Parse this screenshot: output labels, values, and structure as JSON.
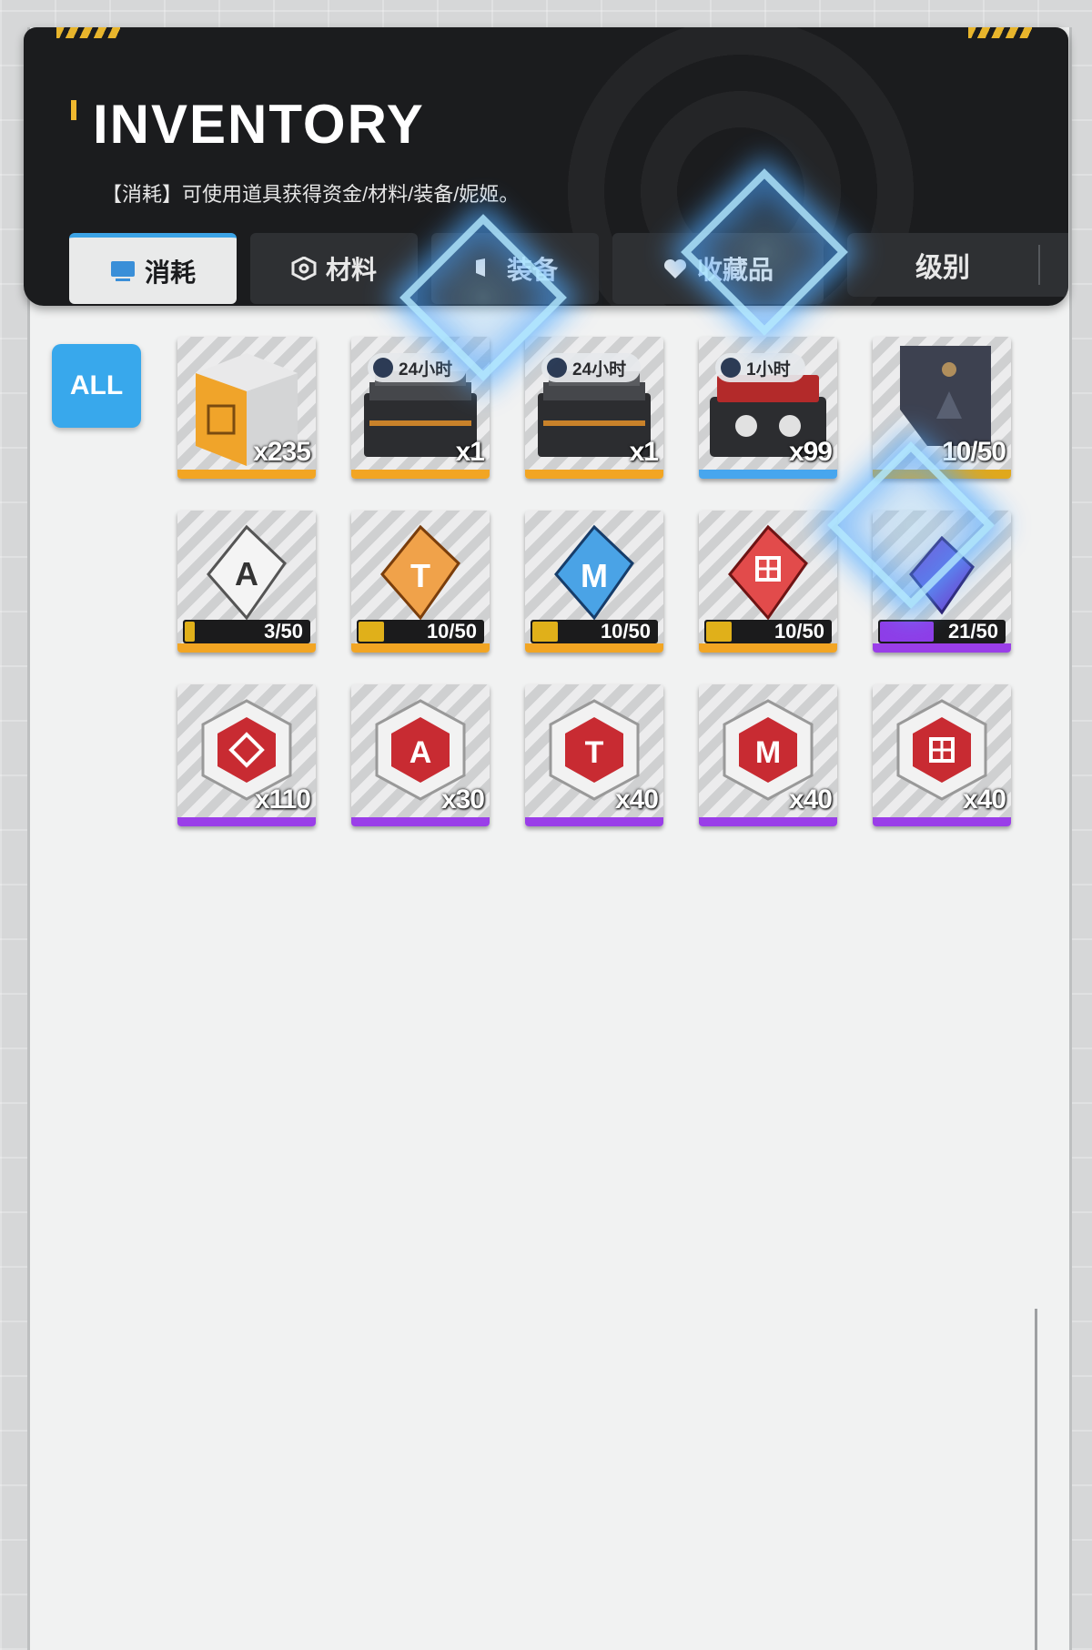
{
  "header": {
    "title": "INVENTORY",
    "subtitle": "【消耗】可使用道具获得资金/材料/装备/妮姬。"
  },
  "tabs": [
    {
      "label": "消耗",
      "icon": "monitor-icon",
      "active": true
    },
    {
      "label": "材料",
      "icon": "hexagon-icon",
      "active": false
    },
    {
      "label": "装备",
      "icon": "equipment-icon",
      "active": false
    },
    {
      "label": "收藏品",
      "icon": "heart-icon",
      "active": false
    }
  ],
  "sort": {
    "label": "级别",
    "arrow": "▼"
  },
  "filter": {
    "all_label": "ALL"
  },
  "colors": {
    "accent": "#38a8ec",
    "rarity_orange": "#f2a523",
    "rarity_blue": "#47a6ee",
    "rarity_purple": "#9a3ee8",
    "header_bg": "#1b1c1e"
  },
  "items": [
    {
      "name": "supply-crate",
      "count": "x235",
      "rarity": "orange"
    },
    {
      "name": "equipment-case",
      "count": "x1",
      "rarity": "orange",
      "timer": "24小时"
    },
    {
      "name": "equipment-case",
      "count": "x1",
      "rarity": "orange",
      "timer": "24小时"
    },
    {
      "name": "gadget-case",
      "count": "x99",
      "rarity": "blue",
      "timer": "1小时"
    },
    {
      "name": "sealed-document",
      "progress": "10/50",
      "rarity": "gold"
    },
    {
      "name": "white-crystal-a",
      "progress": "3/50",
      "progress_value": 0.06
    },
    {
      "name": "orange-crystal-t",
      "progress": "10/50",
      "progress_value": 0.2
    },
    {
      "name": "blue-crystal-m",
      "progress": "10/50",
      "progress_value": 0.2
    },
    {
      "name": "red-crystal-grid",
      "progress": "10/50",
      "progress_value": 0.2
    },
    {
      "name": "purple-crystal",
      "progress": "21/50",
      "progress_value": 0.42
    },
    {
      "name": "red-core-spiral",
      "count": "x110",
      "rarity": "purple"
    },
    {
      "name": "red-core-a",
      "count": "x30",
      "rarity": "purple"
    },
    {
      "name": "red-core-t",
      "count": "x40",
      "rarity": "purple"
    },
    {
      "name": "red-core-m",
      "count": "x40",
      "rarity": "purple"
    },
    {
      "name": "red-core-grid",
      "count": "x40",
      "rarity": "purple"
    }
  ]
}
